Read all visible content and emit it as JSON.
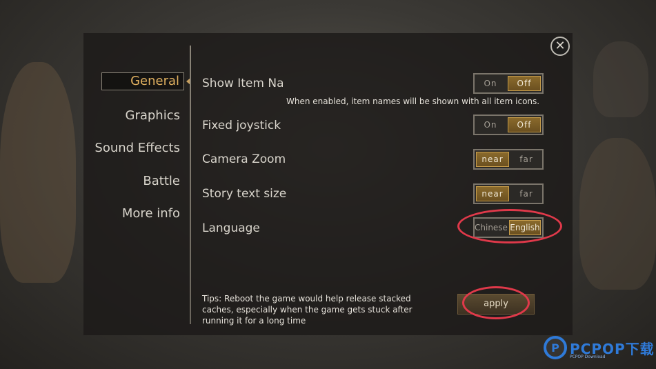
{
  "nav": {
    "general": "General",
    "graphics": "Graphics",
    "sound_effects": "Sound Effects",
    "battle": "Battle",
    "more_info": "More info"
  },
  "settings": {
    "show_item_names": {
      "label": "Show Item Na",
      "on": "On",
      "off": "Off",
      "selected": "off"
    },
    "show_item_hint": "When enabled, item names will be shown with all item icons.",
    "fixed_joystick": {
      "label": "Fixed joystick",
      "on": "On",
      "off": "Off",
      "selected": "off"
    },
    "camera_zoom": {
      "label": "Camera Zoom",
      "near": "near",
      "far": "far",
      "selected": "near"
    },
    "story_text_size": {
      "label": "Story text size",
      "near": "near",
      "far": "far",
      "selected": "near"
    },
    "language": {
      "label": "Language",
      "chinese": "Chinese",
      "english": "English",
      "selected": "english"
    }
  },
  "tips": "Tips: Reboot the game would help release stacked caches, especially when the game gets stuck after running it for a long time",
  "apply_label": "apply",
  "close_symbol": "✕",
  "watermark": {
    "text": "PCPOP下载",
    "sub": "PCPOP Download",
    "logo": "P"
  },
  "colors": {
    "accent_gold": "#c79d4a",
    "annotation_red": "#e0394a",
    "watermark_blue": "#2f7ad8"
  }
}
